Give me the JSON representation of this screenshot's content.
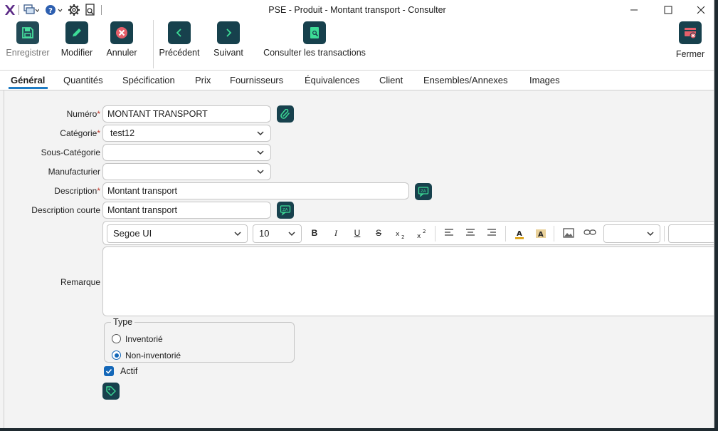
{
  "window": {
    "title": "PSE - Produit - Montant transport - Consulter"
  },
  "toolbar": {
    "save_label": "Enregistrer",
    "edit_label": "Modifier",
    "cancel_label": "Annuler",
    "prev_label": "Précédent",
    "next_label": "Suivant",
    "transactions_label": "Consulter les transactions",
    "close_label": "Fermer"
  },
  "tabs": [
    {
      "label": "Général"
    },
    {
      "label": "Quantités"
    },
    {
      "label": "Spécification"
    },
    {
      "label": "Prix"
    },
    {
      "label": "Fournisseurs"
    },
    {
      "label": "Équivalences"
    },
    {
      "label": "Client"
    },
    {
      "label": "Ensembles/Annexes"
    },
    {
      "label": "Images"
    }
  ],
  "form": {
    "numero_label": "Numéro",
    "numero_value": "MONTANT TRANSPORT",
    "categorie_label": "Catégorie",
    "categorie_value": "test12",
    "sous_categorie_label": "Sous-Catégorie",
    "sous_categorie_value": "",
    "manufacturier_label": "Manufacturier",
    "manufacturier_value": "",
    "description_label": "Description",
    "description_value": "Montant transport",
    "description_courte_label": "Description courte",
    "description_courte_value": "Montant transport",
    "remarque_label": "Remarque",
    "required_mark": "*"
  },
  "editor": {
    "font_family": "Segoe UI",
    "font_size": "10",
    "bold": "B",
    "italic": "I",
    "underline": "U",
    "strike": "S"
  },
  "type_group": {
    "title": "Type",
    "options": [
      {
        "label": "Inventorié",
        "selected": false
      },
      {
        "label": "Non-inventorié",
        "selected": true
      }
    ]
  },
  "actif": {
    "label": "Actif",
    "checked": true
  },
  "colors": {
    "icon_bg": "#17414d",
    "icon_accent": "#3ddc97",
    "tab_underline": "#1f7cc4",
    "check_blue": "#1467b8"
  }
}
